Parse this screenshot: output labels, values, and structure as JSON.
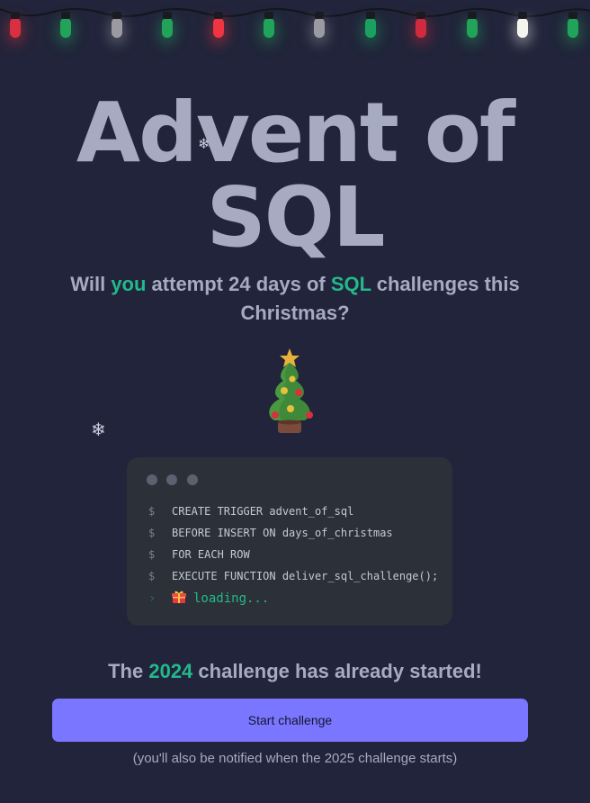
{
  "lights": {
    "colors": [
      "#d9303f",
      "#22a35a",
      "#9a9aa0",
      "#22a35a",
      "#ef3442",
      "#22a35a",
      "#9a9aa0",
      "#1aa160",
      "#cf2a3e",
      "#22a35a",
      "#f4f4ee",
      "#22a35a"
    ]
  },
  "hero": {
    "title_line1": "Advent of",
    "title_line2": "SQL",
    "subtitle_part1": "Will ",
    "subtitle_you": "you",
    "subtitle_part2": " attempt 24 days of ",
    "subtitle_sql": "SQL",
    "subtitle_part3": " challenges this Christmas?"
  },
  "decorations": {
    "snowflake_icon": "snowflake-icon",
    "snowflake_glyph": "❄",
    "tree_icon": "christmas-tree-icon"
  },
  "terminal": {
    "prompt_symbol": "$",
    "lines": [
      "CREATE TRIGGER advent_of_sql",
      "BEFORE INSERT ON days_of_christmas",
      "FOR EACH ROW",
      "EXECUTE FUNCTION deliver_sql_challenge();"
    ],
    "output_prompt": "›",
    "gift_icon": "gift-icon",
    "loading_text": "loading..."
  },
  "status": {
    "part1": "The ",
    "year": "2024",
    "part2": " challenge has already started!"
  },
  "cta": {
    "button_label": "Start challenge",
    "note": "(you'll also be notified when the 2025 challenge starts)"
  },
  "colors": {
    "background": "#21243a",
    "accent_green": "#23b98a",
    "button": "#7a76ff",
    "title_text": "#a6abc1"
  }
}
